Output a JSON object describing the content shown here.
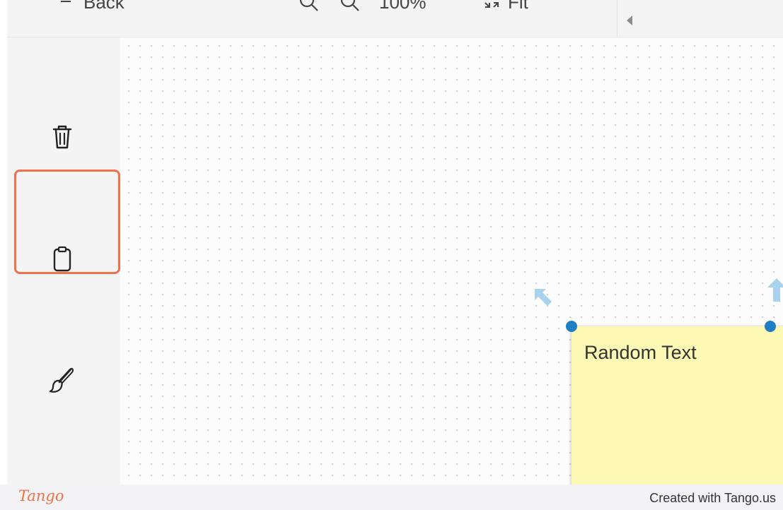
{
  "toolbar": {
    "back_label": "Back",
    "zoom_level": "100%",
    "fit_label": "Fit"
  },
  "sidebar": {
    "items": [
      {
        "name": "delete",
        "icon": "trash-icon"
      },
      {
        "name": "paste",
        "icon": "clipboard-icon",
        "highlighted": true
      },
      {
        "name": "style",
        "icon": "paintbrush-icon"
      }
    ]
  },
  "canvas": {
    "sticky_note": {
      "text": "Random Text",
      "color": "#fdf8b3",
      "handle_color": "#1f7fc4"
    }
  },
  "footer": {
    "logo_text": "Tango",
    "credit_text": "Created with Tango.us"
  },
  "colors": {
    "highlight": "#f0714a",
    "sidebar_bg": "#f4f4f4"
  }
}
